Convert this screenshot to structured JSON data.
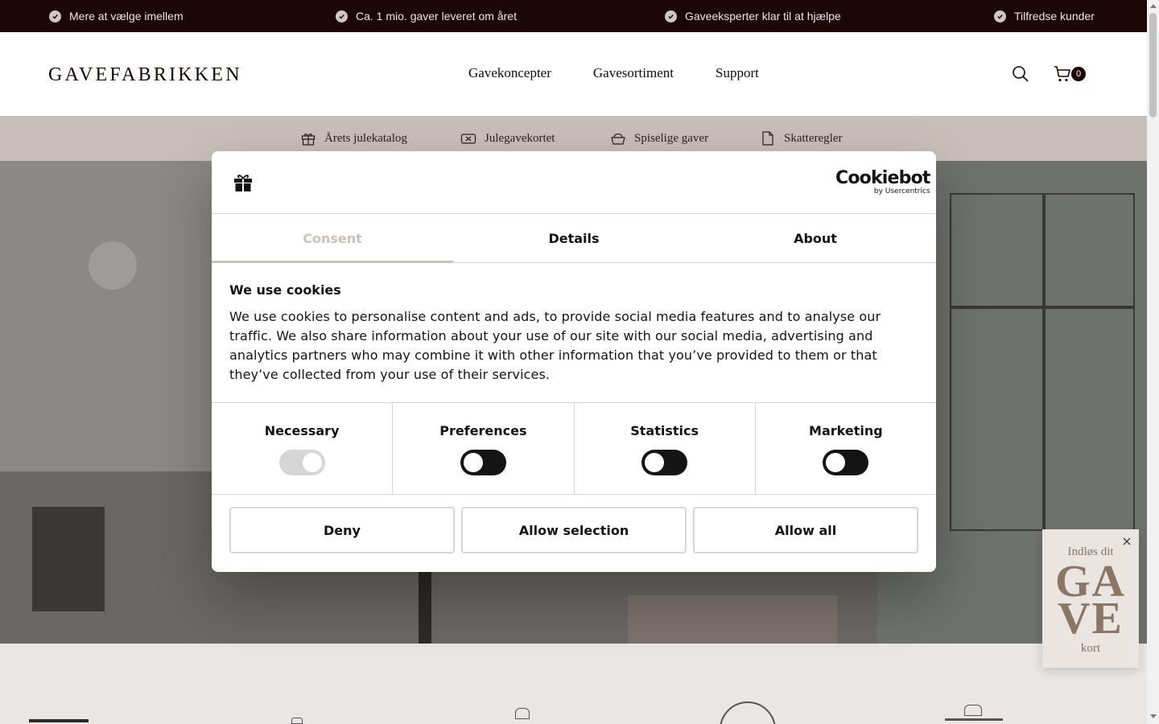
{
  "topbar": {
    "usps": [
      "Mere at vælge imellem",
      "Ca. 1 mio. gaver leveret om året",
      "Gaveeksperter klar til at hjælpe",
      "Tilfredse kunder"
    ]
  },
  "header": {
    "logo": "GAVEFABRIKKEN",
    "nav": [
      "Gavekoncepter",
      "Gavesortiment",
      "Support"
    ],
    "cart_count": "0",
    "icons": [
      "search-icon",
      "cart-icon"
    ]
  },
  "subnav": {
    "items": [
      {
        "label": "Årets julekatalog",
        "icon": "gift-icon"
      },
      {
        "label": "Julegavekortet",
        "icon": "card-icon"
      },
      {
        "label": "Spiselige gaver",
        "icon": "basket-icon"
      },
      {
        "label": "Skatteregler",
        "icon": "document-icon"
      }
    ]
  },
  "cookie_dialog": {
    "brand": "Cookiebot",
    "brand_sub": "by Usercentrics",
    "tabs": [
      "Consent",
      "Details",
      "About"
    ],
    "active_tab": "Consent",
    "title": "We use cookies",
    "text": "We use cookies to personalise content and ads, to provide social media features and to analyse our traffic. We also share information about your use of our site with our social media, advertising and analytics partners who may combine it with other information that you’ve provided to them or that they’ve collected from your use of their services.",
    "categories": [
      {
        "label": "Necessary",
        "enabled": true
      },
      {
        "label": "Preferences",
        "enabled": false
      },
      {
        "label": "Statistics",
        "enabled": false
      },
      {
        "label": "Marketing",
        "enabled": false
      }
    ],
    "buttons": {
      "deny": "Deny",
      "allow_selection": "Allow selection",
      "allow_all": "Allow all"
    }
  },
  "gift_widget": {
    "line1": "Indløs dit",
    "gave": "GAVE",
    "kort": "kort"
  },
  "colors": {
    "topbar_bg": "#1c0606",
    "subnav_bg": "#c8c0b8",
    "widget_text": "#8a7563"
  }
}
